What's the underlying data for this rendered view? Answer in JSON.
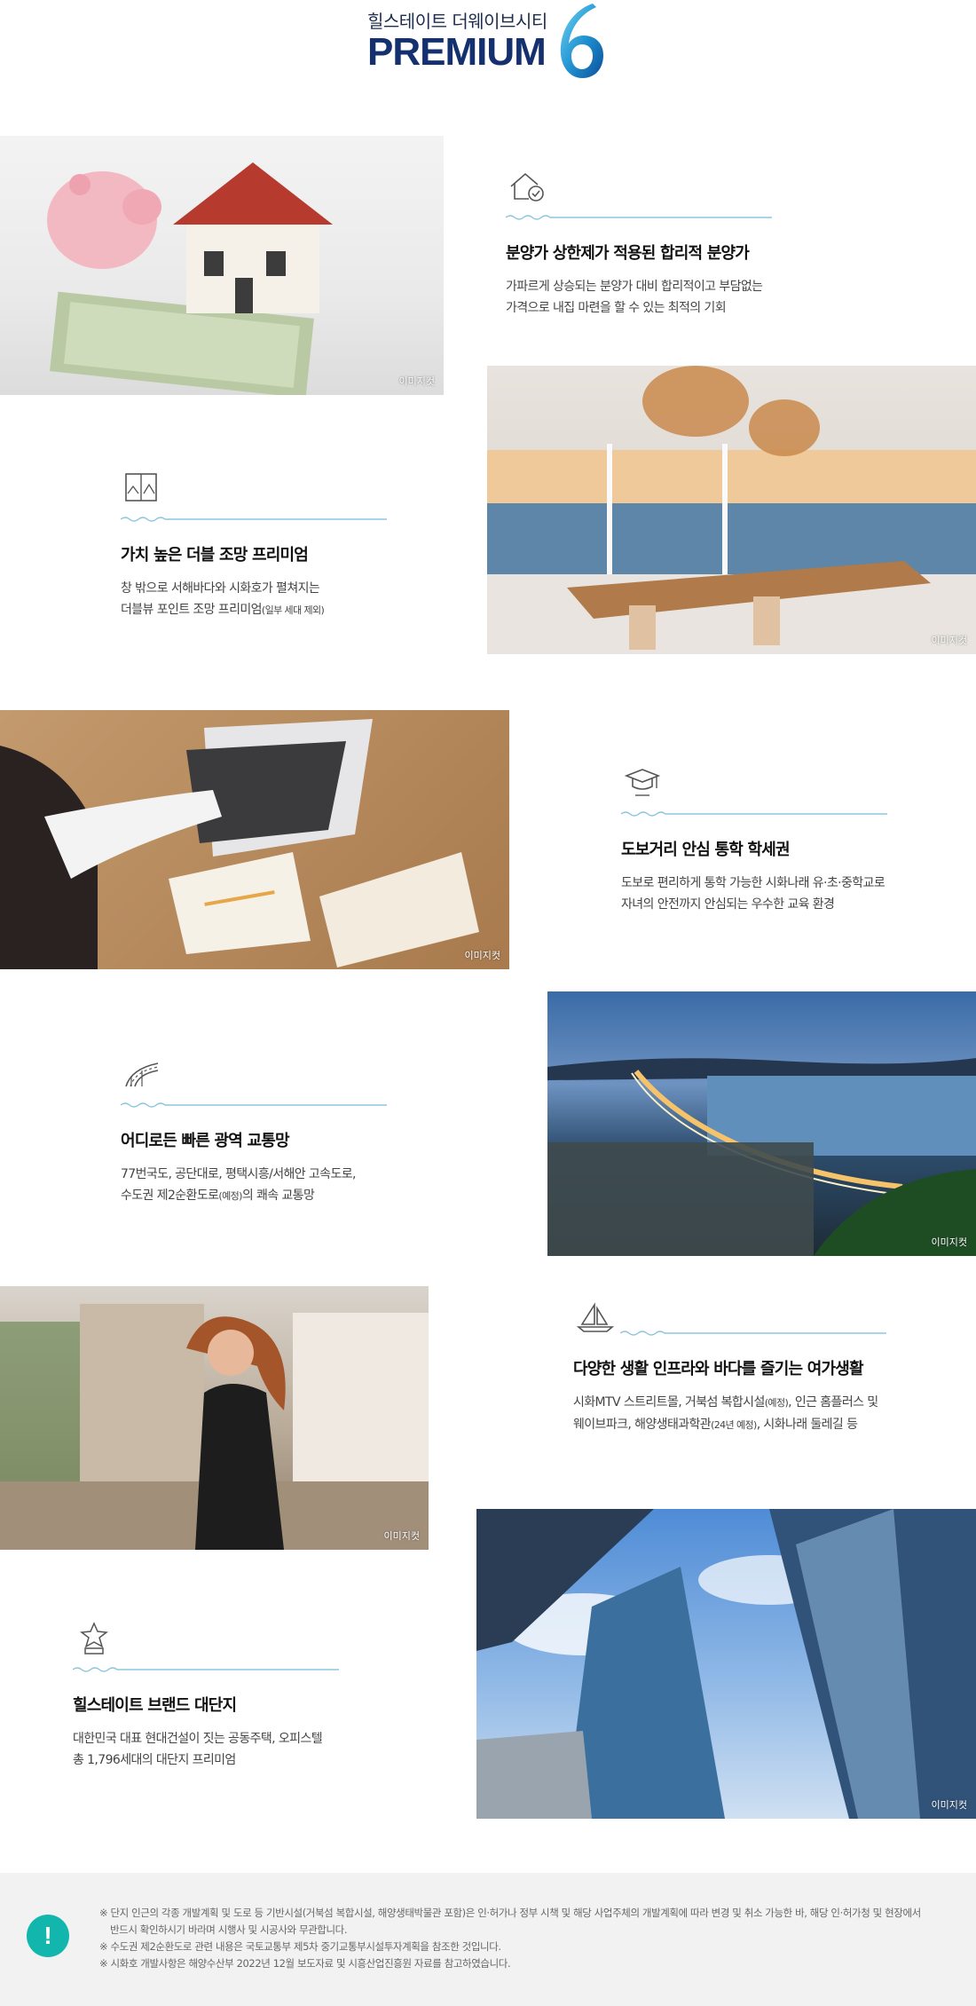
{
  "header": {
    "subtitle": "힐스테이트 더웨이브시티",
    "brand": "PREMIUM",
    "number": "6"
  },
  "image_tag": "이미지컷",
  "features": [
    {
      "icon": "house-check-icon",
      "title": "분양가 상한제가 적용된 합리적 분양가",
      "desc_line1": "가파르게 상승되는 분양가 대비 합리적이고 부담없는",
      "desc_line2": "가격으로 내집 마련을 할 수 있는 최적의 기회",
      "desc_note": ""
    },
    {
      "icon": "window-view-icon",
      "title": "가치 높은 더블 조망 프리미엄",
      "desc_line1": "창 밖으로 서해바다와 시화호가 펼쳐지는",
      "desc_line2": "더블뷰 포인트 조망 프리미엄",
      "desc_note": "(일부 세대 제외)"
    },
    {
      "icon": "graduation-cap-icon",
      "title": "도보거리 안심 통학 학세권",
      "desc_line1": "도보로 편리하게 통학 가능한 시화나래 유·초·중학교로",
      "desc_line2": "자녀의 안전까지 안심되는 우수한 교육 환경",
      "desc_note": ""
    },
    {
      "icon": "road-icon",
      "title": "어디로든 빠른 광역 교통망",
      "desc_line1": "77번국도, 공단대로, 평택시흥/서해안 고속도로,",
      "desc_line2": "수도권 제2순환도로",
      "desc_note": "(예정)",
      "desc_tail": "의 쾌속 교통망"
    },
    {
      "icon": "sailboat-icon",
      "title": "다양한 생활 인프라와 바다를 즐기는 여가생활",
      "desc_line1a": "시화MTV 스트리트몰, 거북섬 복합시설",
      "desc_line1_note": "(예정)",
      "desc_line1b": ", 인근 홈플러스 및",
      "desc_line2": "웨이브파크, 해양생태과학관",
      "desc_note": "(24년 예정)",
      "desc_tail": ", 시화나래 둘레길 등"
    },
    {
      "icon": "trophy-star-icon",
      "title": "힐스테이트 브랜드 대단지",
      "desc_line1": "대한민국 대표 현대건설이 짓는 공동주택, 오피스텔",
      "desc_line2": "총 1,796세대의 대단지 프리미엄",
      "desc_note": ""
    }
  ],
  "notice": {
    "icon": "exclamation-icon",
    "badge": "!",
    "lines": [
      "※ 단지 인근의 각종 개발계획 및 도로 등 기반시설(거북섬 복합시설, 해양생태박물관 포함)은 인·허가나 정부 시책 및 해당 사업주체의 개발계획에 따라 변경 및 취소 가능한 바, 해당 인·허가청 및 현장에서",
      "반드시 확인하시기 바라며 시행사 및 시공사와 무관합니다.",
      "※ 수도권 제2순환도로 관련 내용은 국토교통부 제5차 중기교통부시설투자계획을 참조한 것입니다.",
      "※ 시화호 개발사항은 해양수산부 2022년 12월 보도자료 및 시흥산업진흥원 자료를 참고하였습니다."
    ]
  },
  "colors": {
    "brand_navy": "#14306e",
    "accent_teal": "#13b6ad",
    "line_blue": "#8fc6de"
  }
}
